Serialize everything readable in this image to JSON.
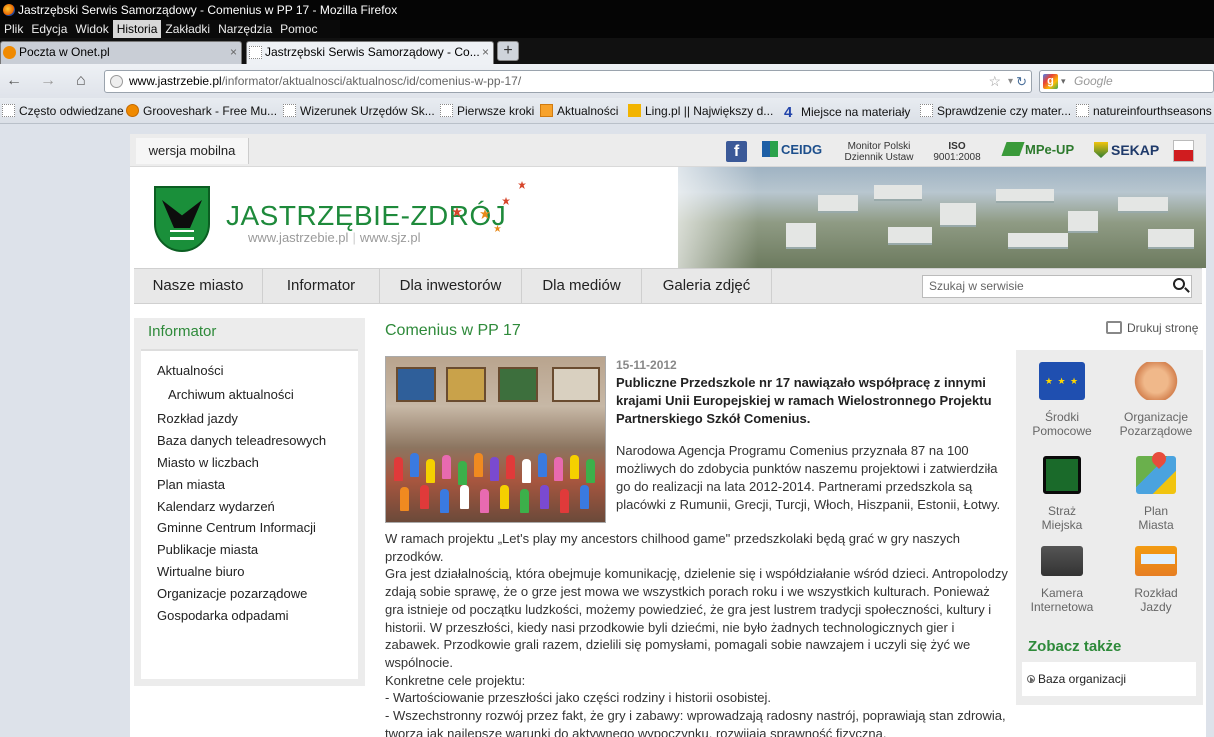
{
  "window": {
    "title": "Jastrzębski Serwis Samorządowy - Comenius w PP 17 - Mozilla Firefox"
  },
  "menu": [
    "Plik",
    "Edycja",
    "Widok",
    "Historia",
    "Zakładki",
    "Narzędzia",
    "Pomoc"
  ],
  "tabs": [
    {
      "label": "Poczta w Onet.pl",
      "close": "×"
    },
    {
      "label": "Jastrzębski Serwis Samorządowy - Co...",
      "close": "×"
    }
  ],
  "new_tab": "+",
  "nav": {
    "back": "←",
    "forward": "→",
    "home": "⌂",
    "url_host": "www.jastrzebie.pl",
    "url_path": "/informator/aktualnosci/aktualnosc/id/comenius-w-pp-17/",
    "star": "☆",
    "dropdown": "▾",
    "reload": "↻",
    "search_logo": "g",
    "search_dropdown": "▾",
    "search_placeholder": "Google"
  },
  "bookmarks": [
    "Często odwiedzane",
    "Grooveshark - Free Mu...",
    "Wizerunek Urzędów Sk...",
    "Pierwsze kroki",
    "Aktualności",
    "Ling.pl || Największy d...",
    "Miejsce na materiały",
    "Sprawdzenie czy mater...",
    "natureinfourthseasons"
  ],
  "bookmark_four": "4",
  "topbar": {
    "mobile": "wersja mobilna",
    "fb": "f",
    "ceidg": "CEIDG",
    "monitor_line1": "Monitor Polski",
    "monitor_line2": "Dziennik Ustaw",
    "iso_line1": "ISO",
    "iso_line2": "9001:2008",
    "mpeup": "MPe-UP",
    "sekap": "SEKAP"
  },
  "brand": {
    "name": "JASTRZĘBIE-ZDRÓJ",
    "url1": "www.jastrzebie.pl",
    "sep": "|",
    "url2": "www.sjz.pl"
  },
  "main_nav": [
    "Nasze miasto",
    "Informator",
    "Dla inwestorów",
    "Dla mediów",
    "Galeria zdjęć"
  ],
  "site_search_placeholder": "Szukaj w serwisie",
  "sidebar": {
    "title": "Informator",
    "items": [
      {
        "label": "Aktualności",
        "sub": false
      },
      {
        "label": "Archiwum aktualności",
        "sub": true
      },
      {
        "label": "Rozkład jazdy",
        "sub": false
      },
      {
        "label": "Baza danych teleadresowych",
        "sub": false
      },
      {
        "label": "Miasto w liczbach",
        "sub": false
      },
      {
        "label": "Plan miasta",
        "sub": false
      },
      {
        "label": "Kalendarz wydarzeń",
        "sub": false
      },
      {
        "label": "Gminne Centrum Informacji",
        "sub": false
      },
      {
        "label": "Publikacje miasta",
        "sub": false
      },
      {
        "label": "Wirtualne biuro",
        "sub": false
      },
      {
        "label": "Organizacje pozarządowe",
        "sub": false
      },
      {
        "label": "Gospodarka odpadami",
        "sub": false
      }
    ]
  },
  "article": {
    "title": "Comenius w PP 17",
    "print": "Drukuj stronę",
    "date": "15-11-2012",
    "lead": "Publiczne Przedszkole nr 17 nawiązało współpracę z innymi krajami Unii Europejskiej w ramach Wielostronnego Projektu Partnerskiego Szkół Comenius.",
    "intro": "Narodowa Agencja Programu Comenius przyznała 87 na 100 możliwych do zdobycia punktów naszemu projektowi i zatwierdziła go do realizacji na lata 2012-2014. Partnerami przedszkola są placówki z Rumunii, Grecji, Turcji, Włoch, Hiszpanii, Estonii, Łotwy.",
    "paragraphs": [
      "W ramach projektu „Let's play my ancestors chilhood game\" przedszkolaki będą grać w gry naszych przodków.",
      "Gra jest działalnością, która obejmuje komunikację, dzielenie się i współdziałanie wśród dzieci. Antropolodzy zdają sobie sprawę, że o grze jest mowa we wszystkich porach roku i we wszystkich kulturach. Ponieważ gra istnieje od początku ludzkości, możemy powiedzieć, że gra jest lustrem tradycji społeczności, kultury i historii. W przeszłości, kiedy nasi przodkowie byli dziećmi, nie było żadnych technologicznych gier i zabawek. Przodkowie grali razem, dzielili się pomysłami, pomagali sobie nawzajem i uczyli się żyć we wspólnocie.",
      "Konkretne cele projektu:",
      "- Wartościowanie przeszłości jako części rodziny i historii osobistej.",
      "- Wszechstronny rozwój przez fakt, że gry i zabawy: wprowadzają radosny nastrój, poprawiają stan zdrowia, tworzą jak najlepsze warunki do aktywnego wypoczynku, rozwijają sprawność fizyczną."
    ]
  },
  "quick_links": [
    {
      "line1": "Środki",
      "line2": "Pomocowe",
      "icon": "eu-flag-icon"
    },
    {
      "line1": "Organizacje",
      "line2": "Pozarządowe",
      "icon": "handshake-icon"
    },
    {
      "line1": "Straż",
      "line2": "Miejska",
      "icon": "city-guard-badge-icon"
    },
    {
      "line1": "Plan",
      "line2": "Miasta",
      "icon": "map-pin-icon"
    },
    {
      "line1": "Kamera",
      "line2": "Internetowa",
      "icon": "video-camera-icon"
    },
    {
      "line1": "Rozkład",
      "line2": "Jazdy",
      "icon": "bus-icon"
    }
  ],
  "see_also": {
    "title": "Zobacz także",
    "link": "Baza organizacji"
  }
}
